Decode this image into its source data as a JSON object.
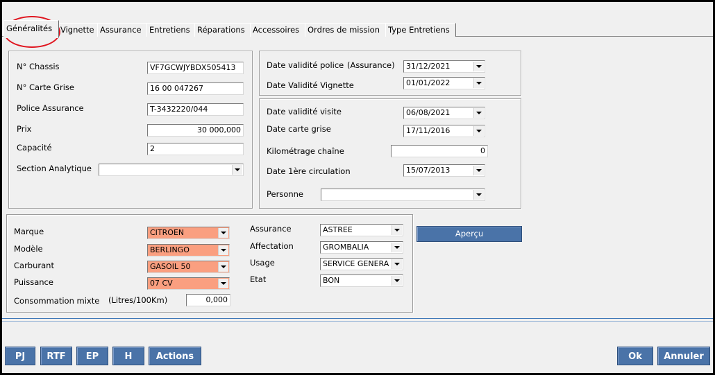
{
  "tabs": [
    {
      "label": "Généralités",
      "active": true
    },
    {
      "label": "Vignette"
    },
    {
      "label": "Assurance"
    },
    {
      "label": "Entretiens"
    },
    {
      "label": "Réparations"
    },
    {
      "label": "Accessoires"
    },
    {
      "label": "Ordres de mission"
    },
    {
      "label": "Type Entretiens"
    }
  ],
  "identity": {
    "chassis_label": "N° Chassis",
    "chassis_value": "VF7GCWJYBDX505413",
    "carte_grise_label": "N° Carte Grise",
    "carte_grise_value": "16 00 047267",
    "police_label": "Police Assurance",
    "police_value": "T-3432220/044",
    "prix_label": "Prix",
    "prix_value": "30 000,000",
    "capacite_label": "Capacité",
    "capacite_value": "2",
    "section_label": "Section Analytique",
    "section_value": ""
  },
  "validity": {
    "police_label": "Date validité police",
    "police_suffix": "(Assurance)",
    "police_value": "31/12/2021",
    "vignette_label": "Date Validité Vignette",
    "vignette_value": "01/01/2022"
  },
  "dates": {
    "visite_label": "Date validité visite",
    "visite_value": "06/08/2021",
    "carte_grise_label": "Date carte grise",
    "carte_grise_value": "17/11/2016",
    "km_label": "Kilométrage chaîne",
    "km_value": "0",
    "circulation_label": "Date 1ère circulation",
    "circulation_value": "15/07/2013",
    "personne_label": "Personne",
    "personne_value": ""
  },
  "vehicle": {
    "marque_label": "Marque",
    "marque_value": "CITROEN",
    "modele_label": "Modèle",
    "modele_value": "BERLINGO",
    "carburant_label": "Carburant",
    "carburant_value": "GASOIL 50",
    "puissance_label": "Puissance",
    "puissance_value": "07 CV",
    "conso_label": "Consommation mixte",
    "conso_unit": "(Litres/100Km)",
    "conso_value": "0,000",
    "assurance_label": "Assurance",
    "assurance_value": "ASTREE",
    "affectation_label": "Affectation",
    "affectation_value": "GROMBALIA",
    "usage_label": "Usage",
    "usage_value": "SERVICE GENERA",
    "etat_label": "Etat",
    "etat_value": "BON",
    "highlight_color": "#fa9f80"
  },
  "apercu_label": "Aperçu",
  "footer": {
    "buttons": [
      "PJ",
      "RTF",
      "EP",
      "H",
      "Actions"
    ],
    "ok_label": "Ok",
    "cancel_label": "Annuler"
  },
  "colors": {
    "button_blue": "#4a73a8",
    "annotation_red": "#e0141e"
  }
}
